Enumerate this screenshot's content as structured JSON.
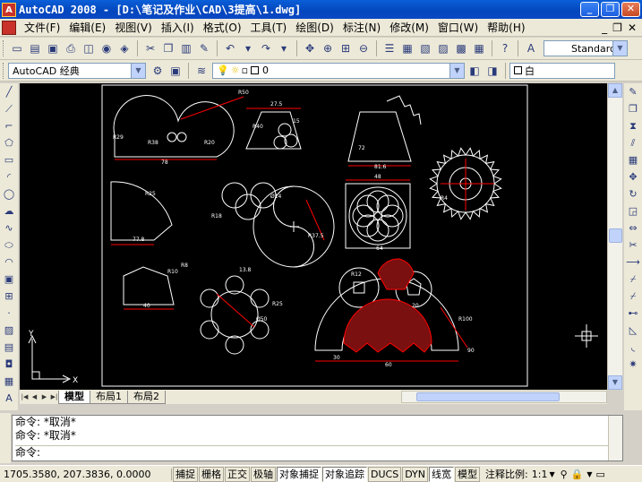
{
  "window": {
    "title": "AutoCAD 2008 - [D:\\笔记及作业\\CAD\\3提高\\1.dwg]",
    "app_icon": "A",
    "controls": [
      "_",
      "❐",
      "✕"
    ]
  },
  "menubar": {
    "items": [
      "文件(F)",
      "编辑(E)",
      "视图(V)",
      "插入(I)",
      "格式(O)",
      "工具(T)",
      "绘图(D)",
      "标注(N)",
      "修改(M)",
      "窗口(W)",
      "帮助(H)"
    ],
    "right_controls": [
      "_",
      "❐",
      "✕"
    ]
  },
  "toolbar_styles": {
    "text_style": "Standard"
  },
  "toolbar_workspace": {
    "workspace": "AutoCAD 经典",
    "layer": "0",
    "color": "白"
  },
  "drawing": {
    "dimension_labels": [
      "R50",
      "R38",
      "R20",
      "78",
      "R29",
      "27.5",
      "R40",
      "15",
      "72",
      "81.6",
      "48",
      "R4",
      "R25",
      "77.8",
      "R18",
      "Ø14",
      "R37.5",
      "64",
      "13.8",
      "Ø50",
      "R25",
      "40",
      "30",
      "R100",
      "20",
      "R12",
      "60",
      "90",
      "R8",
      "R10"
    ],
    "ucs_x": "X",
    "ucs_y": "Y"
  },
  "layout_tabs": [
    "模型",
    "布局1",
    "布局2"
  ],
  "command_history": [
    "命令: *取消*",
    "命令: *取消*"
  ],
  "command_prompt": "命令:",
  "status": {
    "coordinates": "1705.3580, 207.3836, 0.0000",
    "toggles": [
      {
        "label": "捕捉",
        "on": false
      },
      {
        "label": "栅格",
        "on": false
      },
      {
        "label": "正交",
        "on": false
      },
      {
        "label": "极轴",
        "on": false
      },
      {
        "label": "对象捕捉",
        "on": true
      },
      {
        "label": "对象追踪",
        "on": true
      },
      {
        "label": "DUCS",
        "on": false
      },
      {
        "label": "DYN",
        "on": false
      },
      {
        "label": "线宽",
        "on": true
      },
      {
        "label": "模型",
        "on": false
      }
    ],
    "annotation_scale_label": "注释比例:",
    "annotation_scale": "1:1"
  },
  "colors": {
    "titlebar": "#0a4ec8",
    "canvas": "#000000",
    "geometry": "#ffffff",
    "dimension": "#ff0000",
    "hatch": "#ff0000"
  }
}
